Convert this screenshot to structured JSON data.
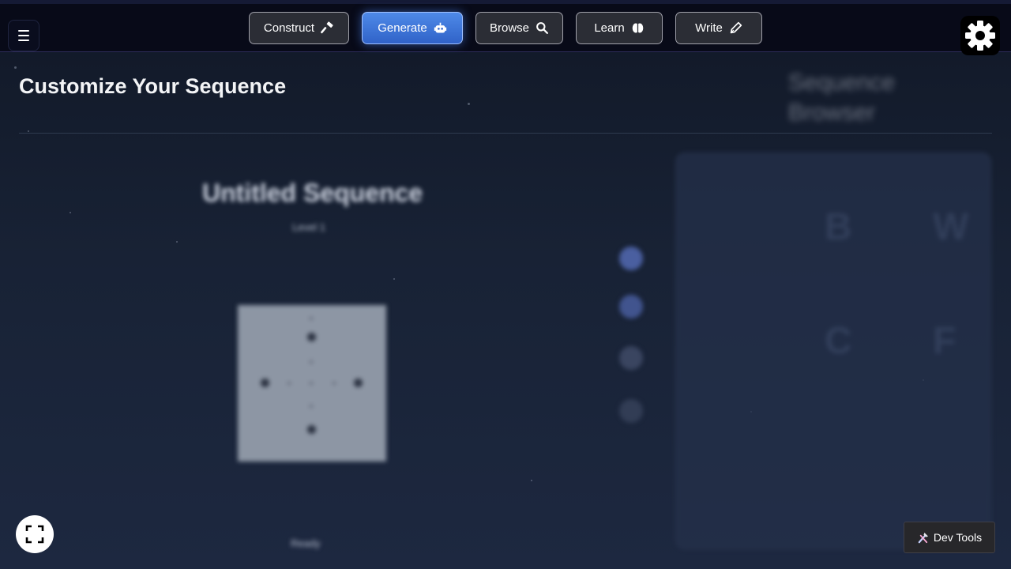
{
  "nav": {
    "items": [
      {
        "label": "Construct",
        "icon": "hammer-icon"
      },
      {
        "label": "Generate",
        "icon": "robot-icon",
        "active": true
      },
      {
        "label": "Browse",
        "icon": "search-icon"
      },
      {
        "label": "Learn",
        "icon": "brain-icon"
      },
      {
        "label": "Write",
        "icon": "pen-icon"
      }
    ],
    "menu_icon": "menu-icon",
    "settings_icon": "gear-icon"
  },
  "page": {
    "title": "Customize Your Sequence"
  },
  "editor": {
    "sequence_title": "Untitled Sequence",
    "level": "Level 1",
    "status": "Ready"
  },
  "browser": {
    "title": "Sequence\nBrowser",
    "letters": [
      "B",
      "W",
      "C",
      "F"
    ]
  },
  "footer": {
    "fullscreen_icon": "fullscreen-icon",
    "dev_tools_label": "Dev Tools",
    "dev_tools_icon": "tools-icon"
  },
  "colors": {
    "accent": "#3f78dc",
    "background": "#182235",
    "topbar": "#080a18"
  }
}
